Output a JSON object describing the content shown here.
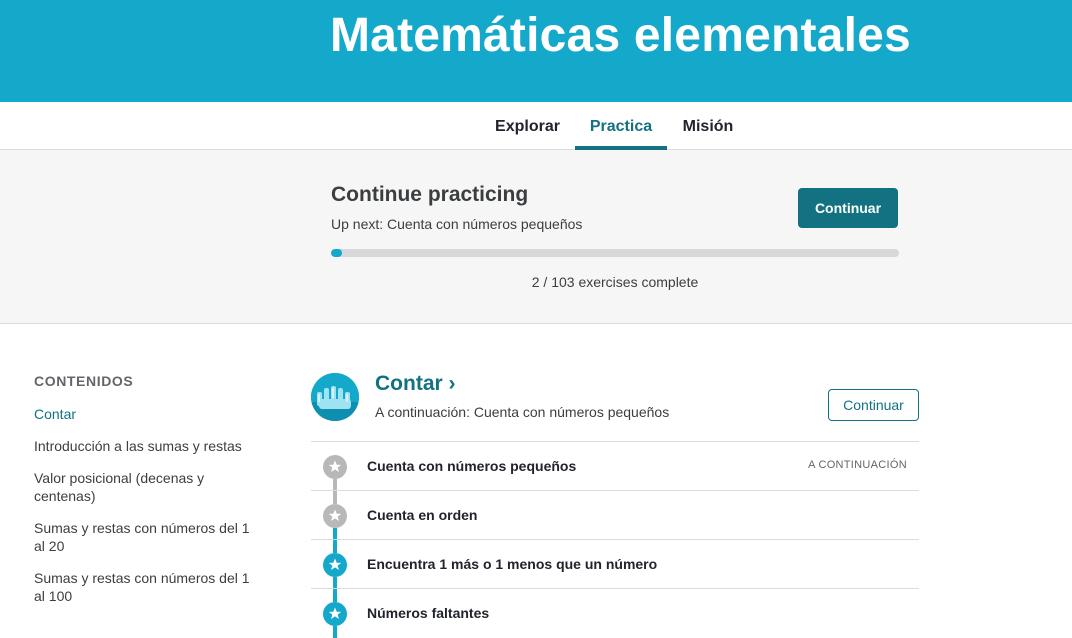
{
  "header": {
    "title": "Matemáticas elementales"
  },
  "tabs": [
    {
      "label": "Explorar"
    },
    {
      "label": "Practica"
    },
    {
      "label": "Misión"
    }
  ],
  "practice": {
    "title": "Continue practicing",
    "up_next": "Up next: Cuenta con números pequeños",
    "button": "Continuar",
    "progress_text": "2 / 103 exercises complete",
    "completed": 2,
    "total": 103
  },
  "sidebar": {
    "heading": "CONTENIDOS",
    "items": [
      {
        "label": "Contar"
      },
      {
        "label": "Introducción a las sumas y restas"
      },
      {
        "label": "Valor posicional (decenas y centenas)"
      },
      {
        "label": "Sumas y restas con números del 1 al 20"
      },
      {
        "label": "Sumas y restas con números del 1 al 100"
      }
    ]
  },
  "unit": {
    "title": "Contar",
    "chevron": "›",
    "up_next": "A continuación: Cuenta con números pequeños",
    "button": "Continuar",
    "skills": [
      {
        "name": "Cuenta con números pequeños",
        "tag": "A CONTINUACIÓN",
        "state": "not-started"
      },
      {
        "name": "Cuenta en orden",
        "tag": "",
        "state": "not-started"
      },
      {
        "name": "Encuentra 1 más o 1 menos que un número",
        "tag": "",
        "state": "started"
      },
      {
        "name": "Números faltantes",
        "tag": "",
        "state": "started"
      }
    ]
  },
  "colors": {
    "brand": "#14a8cb",
    "accent": "#137281",
    "skill_gray": "#b8b8b8"
  }
}
